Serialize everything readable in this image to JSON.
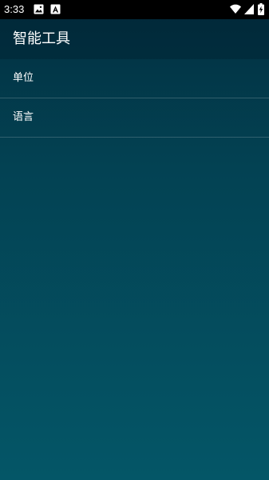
{
  "status_bar": {
    "time": "3:33",
    "notification_icons": [
      "image-icon",
      "font-icon"
    ],
    "system_icons": [
      "wifi-icon",
      "signal-icon",
      "battery-charging-icon"
    ]
  },
  "app_bar": {
    "title": "智能工具"
  },
  "menu": {
    "items": [
      {
        "label": "单位"
      },
      {
        "label": "语言"
      }
    ]
  },
  "colors": {
    "status_bar_bg": "#000000",
    "background_top": "#022f40",
    "background_bottom": "#045667",
    "text": "#ffffff",
    "divider": "rgba(255,255,255,0.18)"
  }
}
